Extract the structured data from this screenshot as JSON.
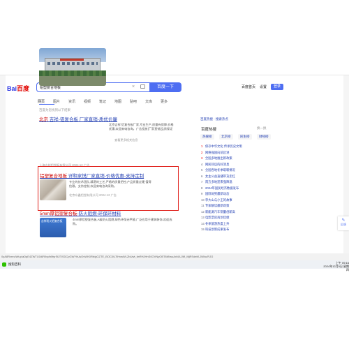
{
  "browser": {
    "logo": {
      "part1": "Bai",
      "part2": "百度"
    },
    "search_value": "铝塑复合地板",
    "search_button": "百度一下",
    "top_links": [
      "百度首页",
      "设置"
    ],
    "login_label": "登录",
    "tabs": [
      "网页",
      "图片",
      "资讯",
      "视频",
      "笔记",
      "地图",
      "贴吧",
      "文库",
      "更多"
    ],
    "tools_label": "百度为您找到以下结果",
    "feedback": "百度热搜 · 搜索热点",
    "hot_title": "百度热搜",
    "hot_refresh": "换一换"
  },
  "results": [
    {
      "title_hl": "北京",
      "title_rest": " 吉祥-铝复合板 厂家直销-质优价廉",
      "snippet": "北京吉祥 铝复合板厂家,专业生产,质量有保障,价格优惠,欢迎来电咨询。广告投放|厂家直销|品质保证",
      "meta": "上海吉祥铝塑板有限公司 2024-12 广告",
      "extra": "查看更多相关信息"
    },
    {
      "title_hl": "铝塑复合地板",
      "title_rest": " 详和家悦厂家直销-价格优惠-支持定制",
      "snippet": "专业的技术团队,精湛的工艺,严格的质量把控,产品质量过硬,值得信赖。支持定制,欢迎来电咨询采购。",
      "meta": "北京众鑫铝塑有限公司 2024-12 广告"
    },
    {
      "title_hl": "5mm厚铝塑复合板",
      "title_rest": "-防火阻燃-环保环材料",
      "thumb_text": "吉祥防火铝复合板",
      "snippet": "4mm厚铝塑复合板,A级防火阻燃,绿色环保无甲醛,广泛应用于建筑装饰,欢迎选购。"
    }
  ],
  "hot_tabs": [
    "热搜榜",
    "北京榜",
    "民生榜",
    "财经榜"
  ],
  "hot_list": [
    "保存中华文化 传承历史文明",
    "网络强国向前迈进",
    "全国多地推出新政策",
    "网民热议的好消息",
    "全国各地冬季取暖情况",
    "女主公益直播带货走红",
    "南方多地迎来强降温",
    "2024年国民经济数据发布",
    "国际局势最新动态",
    "李大山与小王的故事",
    "专家解读最新政策",
    "新能源汽车销量创新高",
    "电影票房再创佳绩",
    "冬季旅游热度上升",
    "科技创新成果发布"
  ],
  "side_button": "反馈",
  "url_text": "0yA8Rvrec/Wup/aDqE4ZWTU1t6R/bp/bMyrSt2T/0DCpGWYhUsOvWK0Rb/gGZTE_BOC0U7lHvwWLZbUwt_fwRHJHnS0OVNyOBT8M/wuAxN/UJM_MjRSdeM-JNNu/RJG",
  "taskbar": {
    "app_label": "搜狗百科",
    "time": "上午 09:16",
    "date": "2024年12月5日 星期四"
  }
}
